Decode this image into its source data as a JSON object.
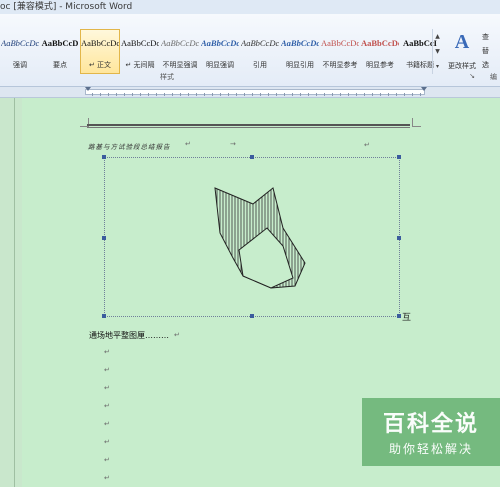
{
  "window": {
    "title": "oc [兼容模式] - Microsoft Word"
  },
  "ribbon": {
    "styles": [
      {
        "sample": "AaBbCcDc",
        "label": "强调",
        "color": "#1f3f7a",
        "bold": false,
        "italic": true
      },
      {
        "sample": "AaBbCcD",
        "label": "要点",
        "color": "#111111",
        "bold": true,
        "italic": false
      },
      {
        "sample": "AaBbCcDc",
        "label": "↵ 正文",
        "color": "#111111",
        "bold": false,
        "italic": false
      },
      {
        "sample": "AaBbCcDc",
        "label": "↵ 无间隔",
        "color": "#111111",
        "bold": false,
        "italic": false
      },
      {
        "sample": "AaBbCcDc",
        "label": "不明显强调",
        "color": "#6b6b6b",
        "bold": false,
        "italic": true
      },
      {
        "sample": "AaBbCcDc",
        "label": "明显强调",
        "color": "#2f5fa8",
        "bold": true,
        "italic": true
      },
      {
        "sample": "AaBbCcDc",
        "label": "引用",
        "color": "#333333",
        "bold": false,
        "italic": true
      },
      {
        "sample": "AaBbCcDc",
        "label": "明显引用",
        "color": "#2f5fa8",
        "bold": true,
        "italic": true
      },
      {
        "sample": "AaBbCcDc",
        "label": "不明显参考",
        "color": "#c0504d",
        "bold": false,
        "italic": false
      },
      {
        "sample": "AaBbCcDc",
        "label": "明显参考",
        "color": "#c0504d",
        "bold": true,
        "italic": false
      },
      {
        "sample": "AaBbCcI",
        "label": "书籍标题",
        "color": "#111111",
        "bold": true,
        "italic": false
      }
    ],
    "group_label": "样式",
    "change_styles_label": "更改样式",
    "edit_items": [
      "查",
      "替",
      "选"
    ],
    "edit_label": "编"
  },
  "document": {
    "header_text": "路基与方试验段总结报告",
    "body_line": "通场地平整图厘………",
    "anchor_label": "互",
    "paragraph_mark": "↵"
  },
  "watermark": {
    "main": "百科全说",
    "sub": "助你轻松解决"
  },
  "colors": {
    "page_bg": "#c7edcc",
    "ribbon_bg": "#e4ecf7",
    "accent": "#2f5fa8",
    "badge": "#6fb679"
  }
}
